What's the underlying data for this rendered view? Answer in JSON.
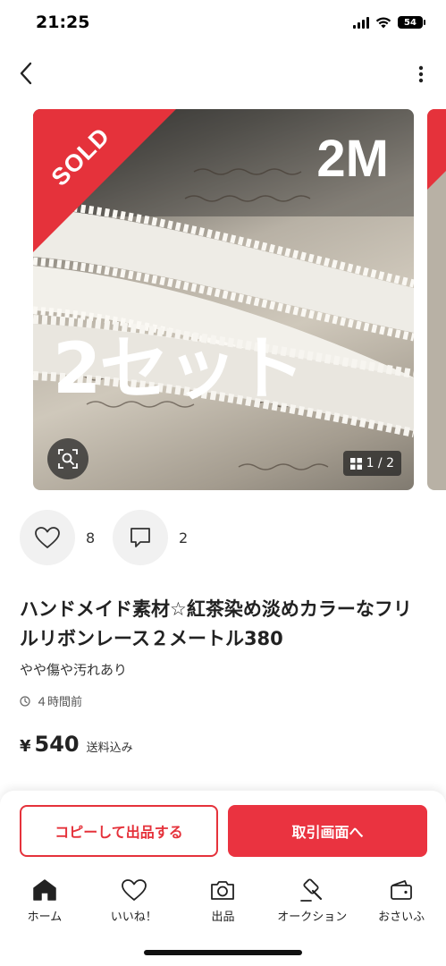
{
  "status_bar": {
    "time": "21:25",
    "battery": "54"
  },
  "colors": {
    "accent": "#e5323b",
    "badge_overlay": "#e5323b"
  },
  "image": {
    "sold_label": "SOLD",
    "overlay_text_top": "2M",
    "overlay_text_main": "2セット",
    "page_indicator": "1 / 2"
  },
  "reactions": {
    "likes": "8",
    "comments": "2"
  },
  "item": {
    "title": "ハンドメイド素材☆紅茶染め淡めカラーなフリルリボンレース２メートル380",
    "condition": "やや傷や汚れあり",
    "posted": "４時間前",
    "price_symbol": "¥",
    "price": "540",
    "price_note": "送料込み"
  },
  "actions": {
    "copy_label": "コピーして出品する",
    "trade_label": "取引画面へ"
  },
  "tabs": [
    {
      "label": "ホーム",
      "icon": "home-icon"
    },
    {
      "label": "いいね！",
      "icon": "heart-icon"
    },
    {
      "label": "出品",
      "icon": "camera-icon"
    },
    {
      "label": "オークション",
      "icon": "gavel-icon"
    },
    {
      "label": "おさいふ",
      "icon": "wallet-icon"
    }
  ]
}
